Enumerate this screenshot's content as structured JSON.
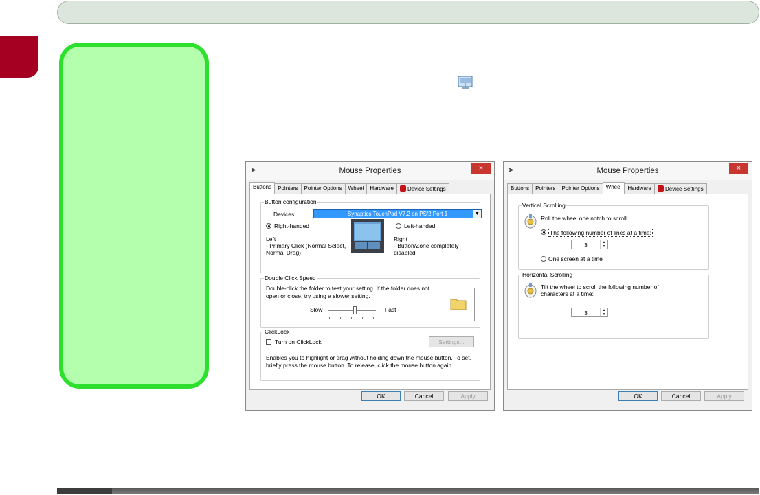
{
  "page": {
    "inline_icon": "mouse-properties-icon"
  },
  "dialog_left": {
    "title": "Mouse Properties",
    "close_label": "×",
    "tabs": [
      "Buttons",
      "Pointers",
      "Pointer Options",
      "Wheel",
      "Hardware",
      "Device Settings"
    ],
    "active_tab": "Buttons",
    "button_config": {
      "label": "Button configuration",
      "devices_label": "Devices:",
      "device_value": "Synaptics TouchPad V7.2 on PS/2 Port 1",
      "right_handed": "Right-handed",
      "left_handed": "Left-handed",
      "left_text": "Left\n- Primary Click (Normal Select, Normal Drag)",
      "right_text": "Right\n- Button/Zone completely disabled"
    },
    "double_click": {
      "label": "Double Click Speed",
      "text": "Double-click the folder to test your setting.  If the folder does not open or close, try using a slower setting.",
      "slow": "Slow",
      "fast": "Fast"
    },
    "clicklock": {
      "label": "ClickLock",
      "checkbox": "Turn on ClickLock",
      "settings_button": "Settings...",
      "text": "Enables you to highlight or drag without holding down the mouse button.  To set, briefly press the mouse button.  To release, click the mouse button again."
    },
    "ok": "OK",
    "cancel": "Cancel",
    "apply": "Apply"
  },
  "dialog_right": {
    "title": "Mouse Properties",
    "close_label": "×",
    "tabs": [
      "Buttons",
      "Pointers",
      "Pointer Options",
      "Wheel",
      "Hardware",
      "Device Settings"
    ],
    "active_tab": "Wheel",
    "vertical": {
      "label": "Vertical Scrolling",
      "text": "Roll the wheel one notch to scroll:",
      "option_lines": "The following number of lines at a time:",
      "lines_value": "3",
      "option_screen": "One screen at a time"
    },
    "horizontal": {
      "label": "Horizontal Scrolling",
      "text": "Tilt the wheel to scroll the following number of characters at a time:",
      "chars_value": "3"
    },
    "ok": "OK",
    "cancel": "Cancel",
    "apply": "Apply"
  }
}
